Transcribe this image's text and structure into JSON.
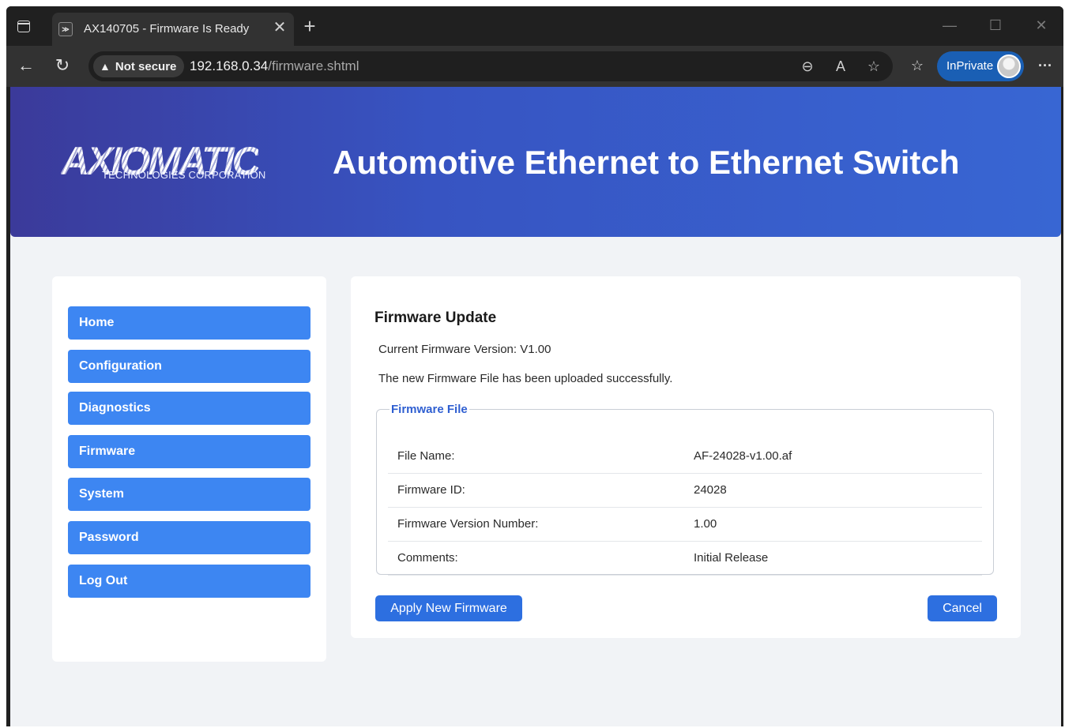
{
  "browser": {
    "tab_title": "AX140705 - Firmware Is Ready",
    "tab_close": "✕",
    "new_tab": "+",
    "not_secure_label": "Not secure",
    "url_host": "192.168.0.34",
    "url_path": "/firmware.shtml",
    "inprivate_label": "InPrivate",
    "icons": [
      "tab-panel-icon",
      "favicon-icon",
      "back-icon",
      "refresh-icon",
      "warning-icon",
      "zoom-out-icon",
      "read-aloud-icon",
      "favorite-star-icon",
      "favorites-list-icon",
      "more-icon",
      "minimize-icon",
      "maximize-icon",
      "close-window-icon"
    ]
  },
  "banner": {
    "logo_text": "AXIOMATIC",
    "logo_subtitle": "TECHNOLOGIES CORPORATION",
    "title": "Automotive Ethernet to Ethernet Switch",
    "colors": {
      "start": "#3b3a9a",
      "end": "#3866d3"
    }
  },
  "sidebar": {
    "items": [
      {
        "label": "Home"
      },
      {
        "label": "Configuration"
      },
      {
        "label": "Diagnostics"
      },
      {
        "label": "Firmware"
      },
      {
        "label": "System"
      },
      {
        "label": "Password"
      },
      {
        "label": "Log Out"
      }
    ],
    "button_color": "#3d86f2"
  },
  "main": {
    "title": "Firmware Update",
    "current_version": "Current Firmware Version: V1.00",
    "upload_message": "The new Firmware File has been uploaded successfully.",
    "file_box": {
      "legend": "Firmware File",
      "rows": [
        {
          "key": "File Name:",
          "value": "AF-24028-v1.00.af"
        },
        {
          "key": "Firmware ID:",
          "value": "24028"
        },
        {
          "key": "Firmware Version Number:",
          "value": "1.00"
        },
        {
          "key": "Comments:",
          "value": "Initial Release"
        }
      ]
    },
    "apply_button": "Apply New Firmware",
    "cancel_button": "Cancel",
    "button_color": "#2d6fe0"
  }
}
